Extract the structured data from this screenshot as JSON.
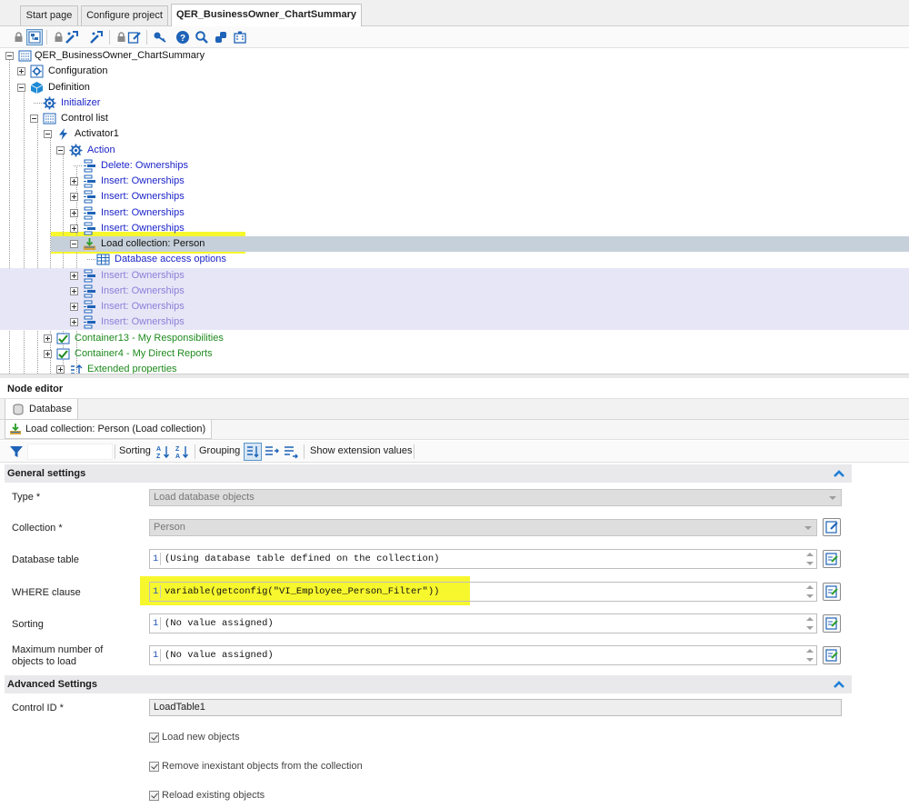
{
  "tabs": [
    {
      "label": "Start page",
      "active": false
    },
    {
      "label": "Configure project",
      "active": false
    },
    {
      "label": "QER_BusinessOwner_ChartSummary",
      "active": true
    }
  ],
  "toolbar": {
    "buttons": [
      "lock-icon",
      "tree-view-icon",
      "lock-icon",
      "wand-icon",
      "wand-icon",
      "lock-icon",
      "edit-icon",
      "key-icon",
      "help-icon",
      "search-icon",
      "component-icon",
      "building-icon"
    ]
  },
  "tree": {
    "nodes": [
      {
        "label": "QER_BusinessOwner_ChartSummary",
        "color": "dark",
        "icon": "form-icon"
      },
      {
        "label": "Configuration",
        "color": "dark",
        "icon": "configuration-icon"
      },
      {
        "label": "Definition",
        "color": "dark",
        "icon": "definition-cube-icon"
      },
      {
        "label": "Initializer",
        "color": "blue",
        "icon": "gear-icon"
      },
      {
        "label": "Control list",
        "color": "dark",
        "icon": "control-list-icon"
      },
      {
        "label": "Activator1",
        "color": "dark",
        "icon": "lightning-icon"
      },
      {
        "label": "Action",
        "color": "blue",
        "icon": "gear-icon"
      },
      {
        "label": "Delete: Ownerships",
        "color": "blue",
        "icon": "action-step-icon"
      },
      {
        "label": "Insert: Ownerships",
        "color": "blue",
        "icon": "action-step-icon"
      },
      {
        "label": "Insert: Ownerships",
        "color": "blue",
        "icon": "action-step-icon"
      },
      {
        "label": "Insert: Ownerships",
        "color": "blue",
        "icon": "action-step-icon"
      },
      {
        "label": "Insert: Ownerships",
        "color": "blue",
        "icon": "action-step-icon"
      },
      {
        "label": "Load collection: Person",
        "color": "dark",
        "icon": "load-collection-icon"
      },
      {
        "label": "Database access options",
        "color": "blue",
        "icon": "table-grid-icon"
      },
      {
        "label": "Insert: Ownerships",
        "color": "purple",
        "icon": "action-step-icon"
      },
      {
        "label": "Insert: Ownerships",
        "color": "purple",
        "icon": "action-step-icon"
      },
      {
        "label": "Insert: Ownerships",
        "color": "purple",
        "icon": "action-step-icon"
      },
      {
        "label": "Insert: Ownerships",
        "color": "purple",
        "icon": "action-step-icon"
      },
      {
        "label": "Container13 - My Responsibilities",
        "color": "green",
        "icon": "container-icon"
      },
      {
        "label": "Container4 - My Direct Reports",
        "color": "green",
        "icon": "container-icon"
      },
      {
        "label": "Extended properties",
        "color": "green",
        "icon": "properties-icon"
      }
    ]
  },
  "node_editor": {
    "title": "Node editor",
    "tab_label": "Database",
    "subtab_label": "Load collection: Person (Load collection)",
    "tools": {
      "sorting_label": "Sorting",
      "grouping_label": "Grouping",
      "show_extension_label": "Show extension values"
    },
    "general": {
      "title": "General settings",
      "type_label": "Type *",
      "type_value": "Load database objects",
      "collection_label": "Collection *",
      "collection_value": "Person",
      "dbtable_label": "Database table",
      "dbtable_value": "(Using database table defined on the collection)",
      "where_label": "WHERE clause",
      "where_value": "variable(getconfig(\"VI_Employee_Person_Filter\"))",
      "sorting_label": "Sorting",
      "sorting_value": "(No value assigned)",
      "max_label": "Maximum number of objects to load",
      "max_value": "(No value assigned)",
      "line_number": "1"
    },
    "advanced": {
      "title": "Advanced Settings",
      "control_id_label": "Control ID *",
      "control_id_value": "LoadTable1",
      "load_new_label": "Load new objects",
      "load_new_checked": true,
      "remove_label": "Remove inexistant objects from the collection",
      "remove_checked": true,
      "reload_label": "Reload existing objects",
      "reload_checked": true
    }
  },
  "colors": {
    "highlight": "#f7f72e",
    "selected_row": "#c6d0da",
    "band_row": "#e6e6f7",
    "link_blue": "#1c24c9",
    "container_green": "#1d8a1d"
  }
}
